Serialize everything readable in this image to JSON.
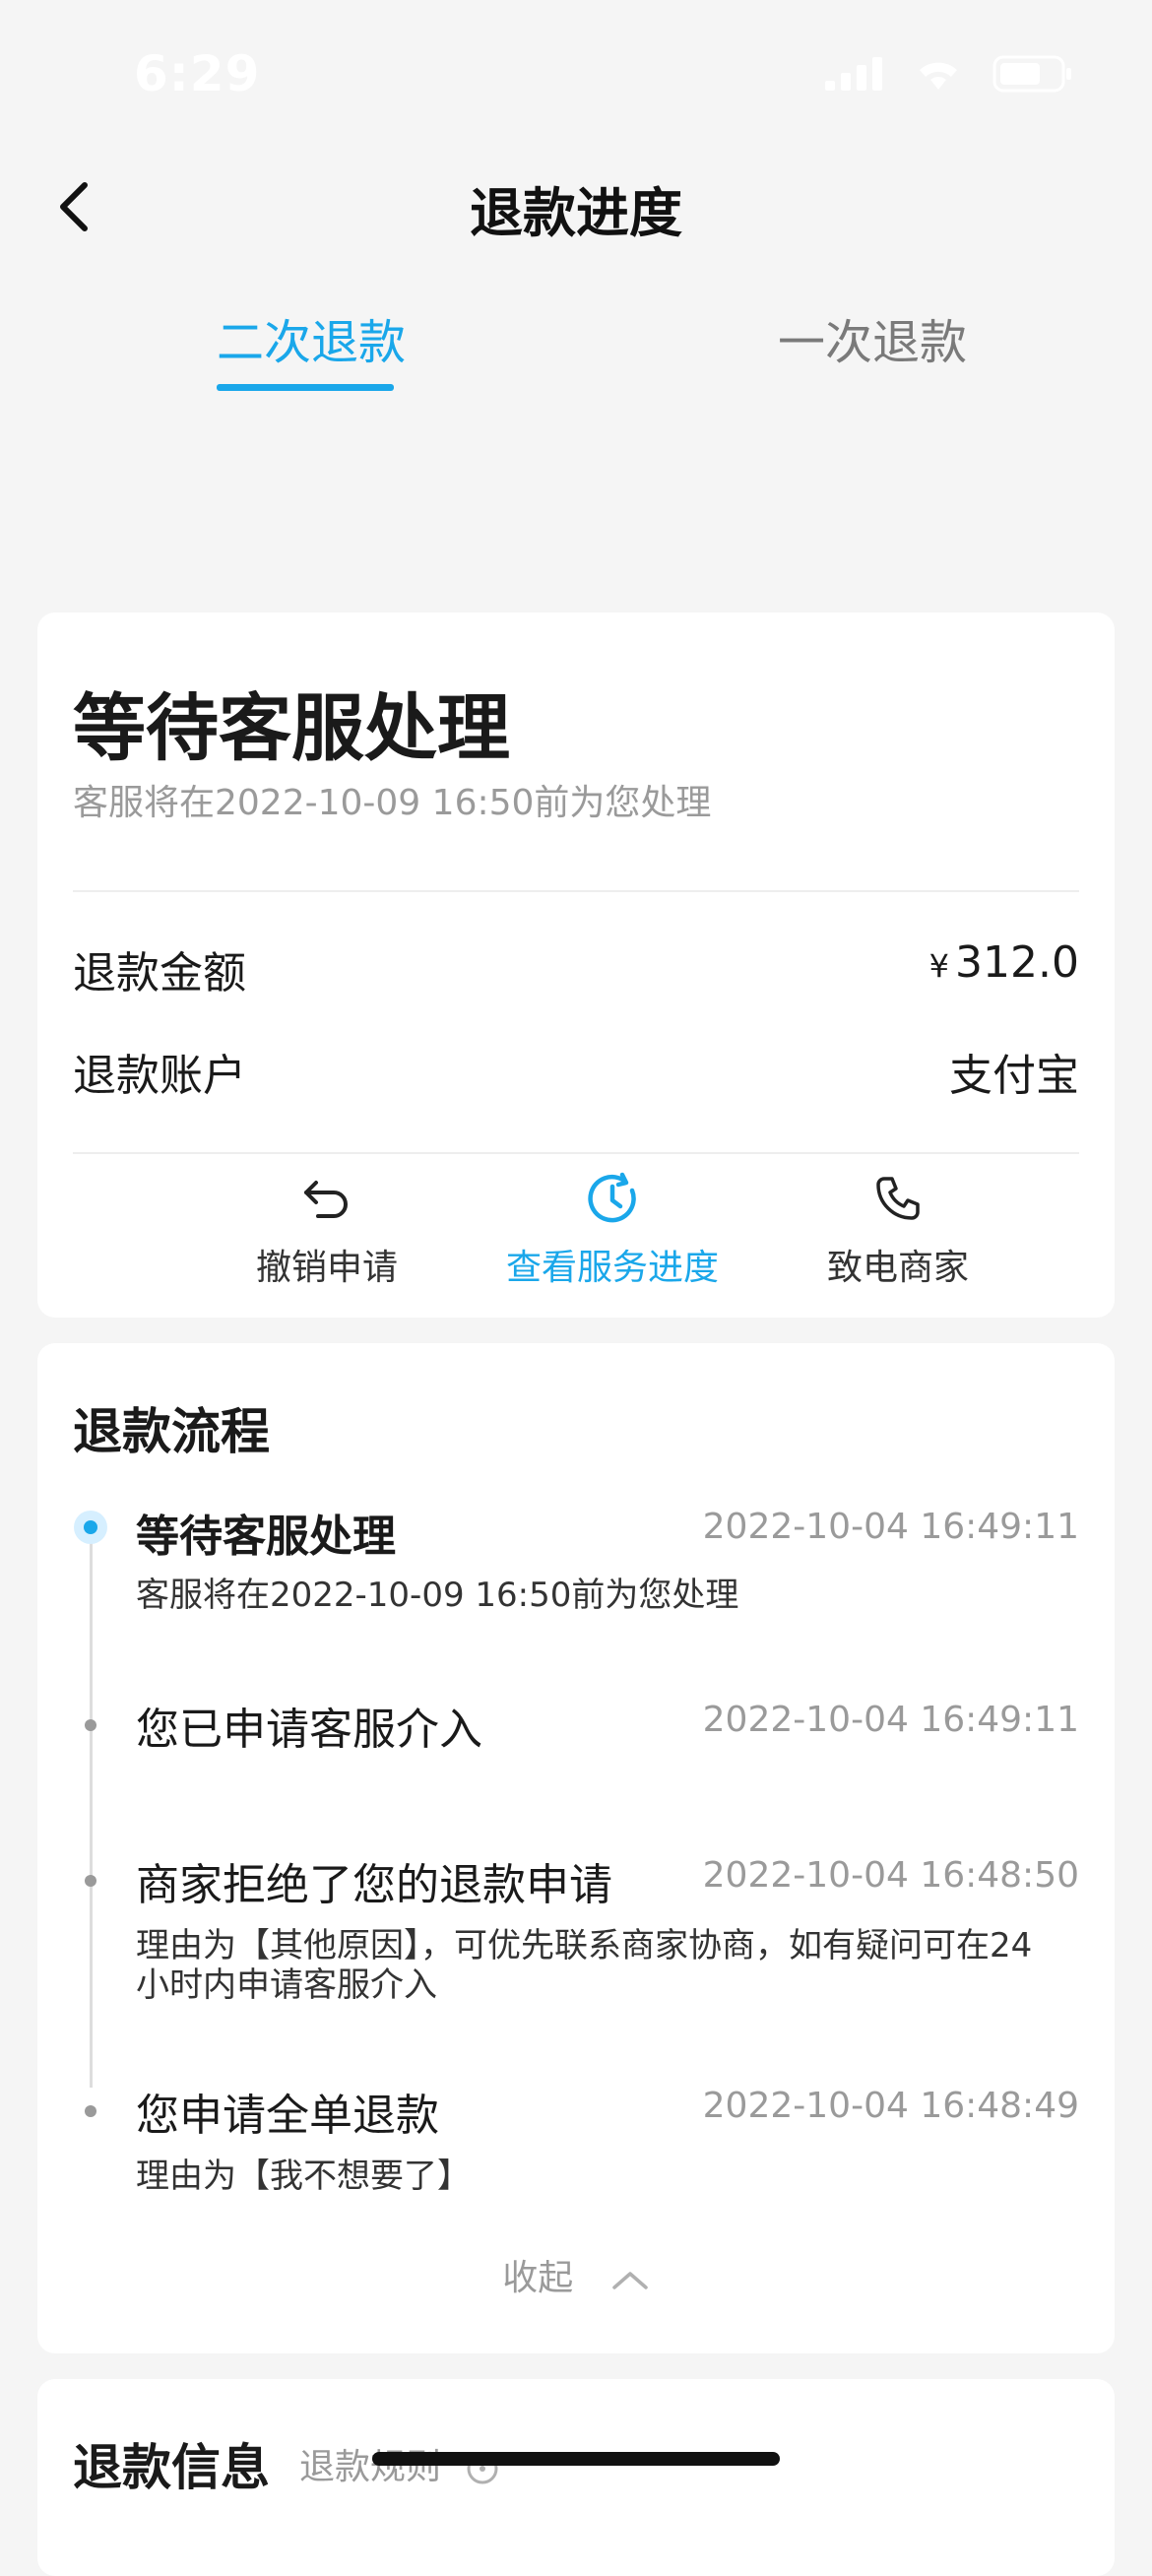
{
  "status_bar": {
    "time": "6:29"
  },
  "nav": {
    "title": "退款进度"
  },
  "tabs": [
    {
      "label": "二次退款",
      "active": true
    },
    {
      "label": "一次退款",
      "active": false
    }
  ],
  "status_card": {
    "title": "等待客服处理",
    "subtitle": "客服将在2022-10-09 16:50前为您处理",
    "amount_label": "退款金额",
    "currency": "¥",
    "amount_value": "312.0",
    "account_label": "退款账户",
    "account_value": "支付宝",
    "actions": [
      {
        "label": "撤销申请",
        "icon": "undo-icon"
      },
      {
        "label": "查看服务进度",
        "icon": "clock-refresh-icon"
      },
      {
        "label": "致电商家",
        "icon": "phone-icon"
      }
    ]
  },
  "flow": {
    "title": "退款流程",
    "steps": [
      {
        "title": "等待客服处理",
        "time": "2022-10-04 16:49:11",
        "desc": "客服将在2022-10-09 16:50前为您处理"
      },
      {
        "title": "您已申请客服介入",
        "time": "2022-10-04 16:49:11",
        "desc": ""
      },
      {
        "title": "商家拒绝了您的退款申请",
        "time": "2022-10-04 16:48:50",
        "desc": "理由为【其他原因】，可优先联系商家协商，如有疑问可在24小时内申请客服介入"
      },
      {
        "title": "您申请全单退款",
        "time": "2022-10-04 16:48:49",
        "desc": "理由为【我不想要了】"
      }
    ],
    "collapse_label": "收起"
  },
  "info": {
    "title": "退款信息",
    "rule_label": "退款规则"
  },
  "colors": {
    "accent": "#1aa7ea",
    "background": "#f5f5f5"
  }
}
